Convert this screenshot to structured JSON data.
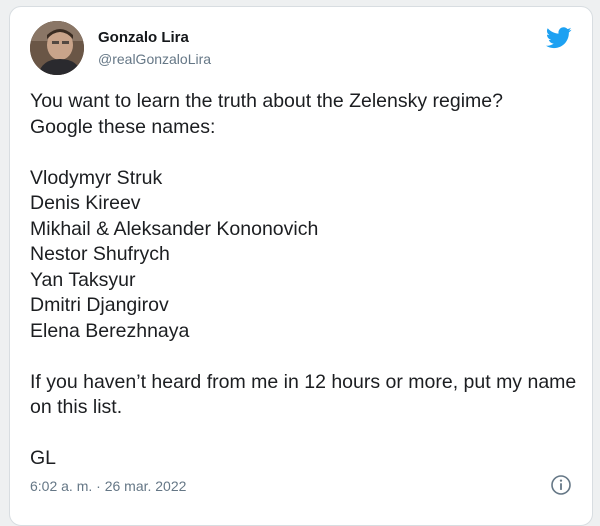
{
  "user": {
    "name": "Gonzalo Lira",
    "handle": "@realGonzaloLira"
  },
  "tweet": {
    "intro_line1": "You want to learn the truth about the Zelensky regime?",
    "intro_line2": "Google these names:",
    "names": [
      "Vlodymyr Struk",
      "Denis Kireev",
      "Mikhail & Aleksander Kononovich",
      "Nestor Shufrych",
      "Yan Taksyur",
      "Dmitri Djangirov",
      "Elena Berezhnaya"
    ],
    "warning": "If you haven’t heard from me in 12 hours or more, put my name on this list.",
    "signoff": "GL"
  },
  "footer": {
    "timestamp": "6:02 a. m. · 26 mar. 2022"
  },
  "icons": {
    "brand": "twitter-bird-icon",
    "info": "info-icon"
  },
  "colors": {
    "brand_blue": "#1da1f2",
    "secondary_text": "#657786"
  }
}
